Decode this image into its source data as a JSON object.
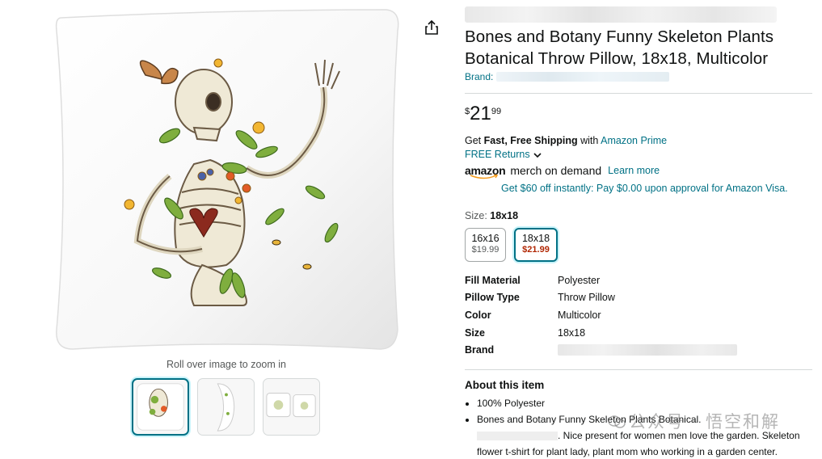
{
  "product": {
    "title": "Bones and Botany Funny Skeleton Plants Botanical Throw Pillow, 18x18, Multicolor",
    "brand_label": "Brand: "
  },
  "gallery": {
    "zoom_hint": "Roll over image to zoom in",
    "thumbnail_count": 3,
    "active_thumbnail": 1
  },
  "price": {
    "symbol": "$",
    "whole": "21",
    "fraction": "99"
  },
  "shipping": {
    "prefix": "Get ",
    "bold": "Fast, Free Shipping",
    "middle": " with ",
    "prime_link": "Amazon Prime",
    "returns": "FREE Returns"
  },
  "merch": {
    "logo_text": "amazon",
    "tagline": "merch on demand",
    "learn_more": "Learn more"
  },
  "visa_offer": "Get $60 off instantly: Pay $0.00 upon approval for Amazon Visa.",
  "size": {
    "label": "Size: ",
    "selected": "18x18",
    "options": [
      {
        "size": "16x16",
        "price": "$19.99"
      },
      {
        "size": "18x18",
        "price": "$21.99"
      }
    ]
  },
  "specs": [
    {
      "key": "Fill Material",
      "value": "Polyester"
    },
    {
      "key": "Pillow Type",
      "value": "Throw Pillow"
    },
    {
      "key": "Color",
      "value": "Multicolor"
    },
    {
      "key": "Size",
      "value": "18x18"
    },
    {
      "key": "Brand",
      "value": ""
    }
  ],
  "about": {
    "heading": "About this item",
    "bullets": [
      "100% Polyester",
      "Bones and Botany Funny Skeleton Plants Botanical.",
      ". Nice present for women men love the garden. Skeleton flower t-shirt for plant lady, plant mom who working in a garden center."
    ]
  },
  "watermark": "公众号 · 悟空和解",
  "colors": {
    "link": "#007185",
    "price_red": "#b12704",
    "selected_border": "#007185"
  }
}
